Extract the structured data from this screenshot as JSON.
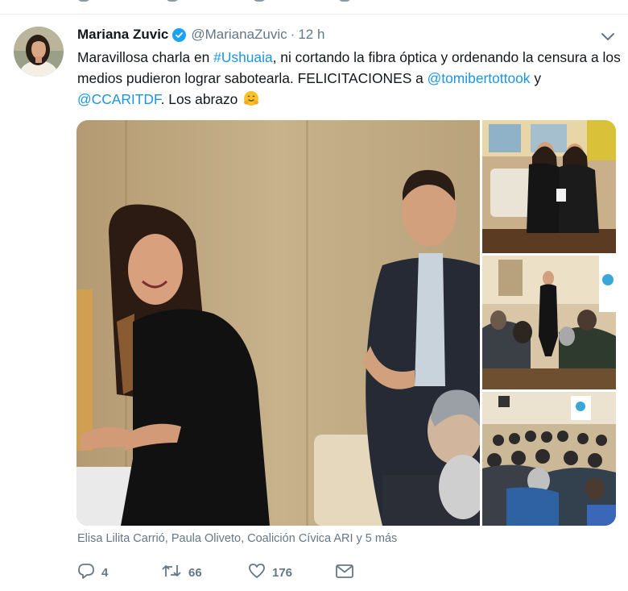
{
  "tweet": {
    "author_name": "Mariana Zuvic",
    "handle": "@MarianaZuvic",
    "separator": "·",
    "time": "12 h",
    "text": {
      "part1": "Maravillosa charla en ",
      "hashtag": "#Ushuaia",
      "part2": ", ni cortando la fibra óptica y ordenando la censura a los medios pudieron lograr sabotearla. FELICITACIONES a ",
      "mention1": "@tomibertottook",
      "part3": " y ",
      "mention2": "@CCARITDF",
      "part4": ". Los abrazo"
    },
    "tagged_people": "Elisa Lilita Carrió, Paula Oliveto, Coalición Cívica ARI y 5 más",
    "counts": {
      "replies": "4",
      "retweets": "66",
      "likes": "176"
    }
  },
  "icons": {
    "verified": "verified-badge-icon",
    "menu": "chevron-down-icon",
    "reply": "reply-icon",
    "retweet": "retweet-icon",
    "like": "heart-icon",
    "message": "envelope-icon",
    "emoji": "hugging-face-emoji"
  },
  "colors": {
    "link": "#1b95e0",
    "verified": "#1da1f2",
    "secondary_text": "#657786",
    "primary_text": "#14171a"
  }
}
